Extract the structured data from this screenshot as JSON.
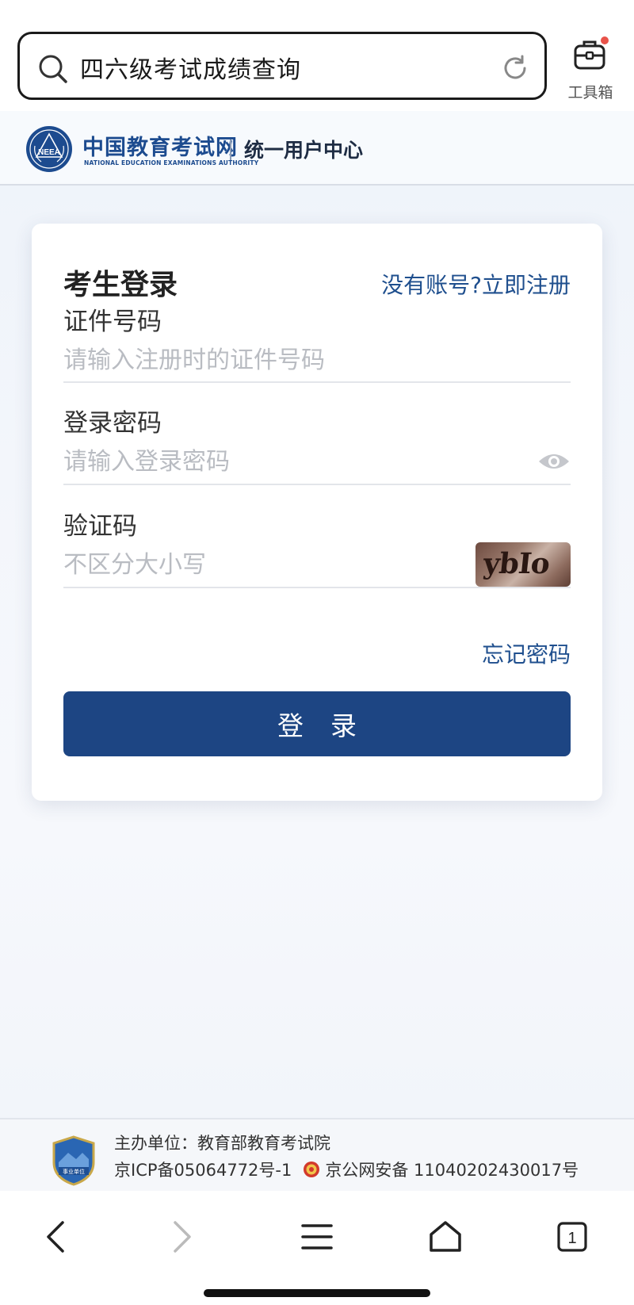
{
  "browser": {
    "search_text": "四六级考试成绩查询",
    "toolbox_label": "工具箱"
  },
  "site": {
    "brand_cn": "中国教育考试网",
    "brand_en": "NATIONAL EDUCATION EXAMINATIONS AUTHORITY",
    "logo_text": "NEEA",
    "center_title": "统一用户中心"
  },
  "login": {
    "title": "考生登录",
    "register_link": "没有账号?立即注册",
    "id_label": "证件号码",
    "id_placeholder": "请输入注册时的证件号码",
    "password_label": "登录密码",
    "password_placeholder": "请输入登录密码",
    "captcha_label": "验证码",
    "captcha_placeholder": "不区分大小写",
    "captcha_text": "ybIo",
    "forgot_link": "忘记密码",
    "submit_label": "登录"
  },
  "footer": {
    "sponsor": "主办单位：教育部教育考试院",
    "icp": "京ICP备05064772号-1",
    "police": "京公网安备 11040202430017号",
    "badge_text": "事业单位"
  },
  "nav": {
    "tab_count": "1"
  },
  "colors": {
    "primary": "#1d4583",
    "link": "#1f4f8e",
    "badge_dot": "#e9534a"
  }
}
